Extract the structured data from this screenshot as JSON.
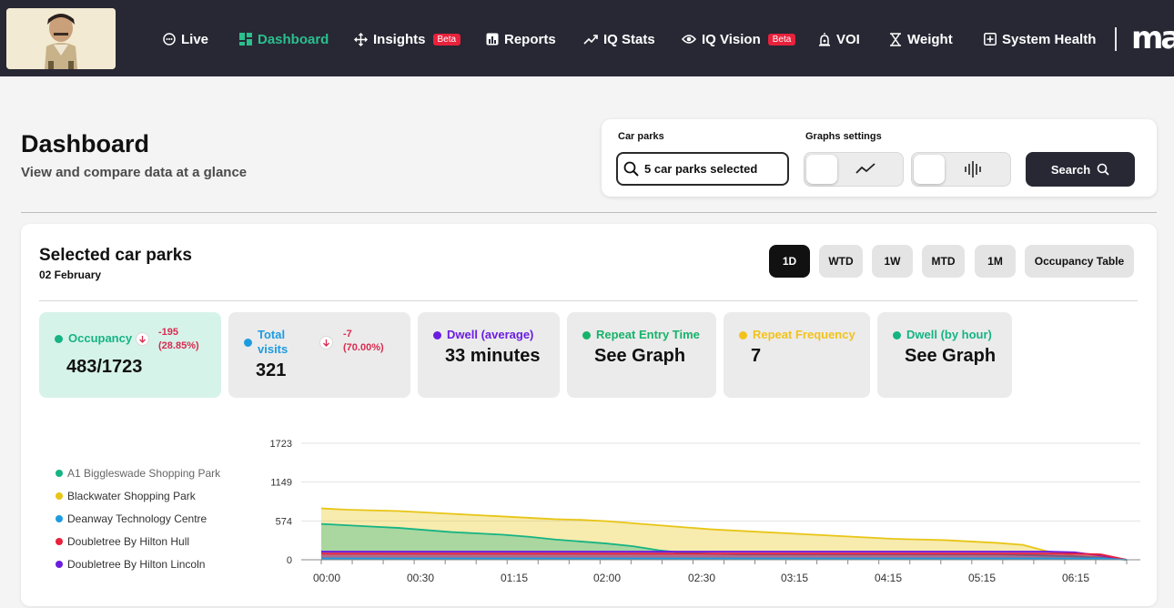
{
  "nav": {
    "items": [
      {
        "label": "Live",
        "icon": "live-circle-icon"
      },
      {
        "label": "Dashboard",
        "icon": "dashboard-grid-icon",
        "active": true
      },
      {
        "label": "Insights",
        "icon": "insights-move-icon",
        "badge": "Beta"
      },
      {
        "label": "Reports",
        "icon": "reports-bar-icon"
      },
      {
        "label": "IQ Stats",
        "icon": "trend-line-icon"
      },
      {
        "label": "IQ Vision",
        "icon": "eye-icon",
        "badge": "Beta"
      },
      {
        "label": "VOI",
        "icon": "alarm-bell-icon"
      },
      {
        "label": "Weight",
        "icon": "hourglass-icon"
      },
      {
        "label": "System Health",
        "icon": "plus-square-icon"
      }
    ],
    "brand": "mav",
    "active_color": "#2bbf8e",
    "badge_color": "#e8213c"
  },
  "header": {
    "title": "Dashboard",
    "subtitle": "View and compare data at a glance"
  },
  "filters": {
    "car_parks_label": "Car parks",
    "car_parks_value": "5 car parks selected",
    "graph_settings_label": "Graphs settings",
    "search_label": "Search"
  },
  "card": {
    "title": "Selected car parks",
    "date": "02 February",
    "ranges": [
      {
        "label": "1D",
        "active": true
      },
      {
        "label": "WTD"
      },
      {
        "label": "1W"
      },
      {
        "label": "MTD"
      },
      {
        "label": "1M"
      },
      {
        "label": "Occupancy Table"
      }
    ]
  },
  "stats": [
    {
      "label": "Occupancy",
      "value": "483/1723",
      "delta_line1": "-195",
      "delta_line2": "(28.85%)",
      "color": "#16b383"
    },
    {
      "label": "Total visits",
      "value": "321",
      "delta_line1": "-7",
      "delta_line2": "(70.00%)",
      "color": "#1e9be0"
    },
    {
      "label": "Dwell (average)",
      "value": "33 minutes",
      "color": "#6a1de0"
    },
    {
      "label": "Repeat Entry Time",
      "value": "See Graph",
      "color": "#16b36a"
    },
    {
      "label": "Repeat Frequency",
      "value": "7",
      "color": "#f2c21b"
    },
    {
      "label": "Dwell (by hour)",
      "value": "See Graph",
      "color": "#16b383"
    }
  ],
  "legend": [
    {
      "name": "A1 Biggleswade Shopping Park",
      "color": "#16b383"
    },
    {
      "name": "Blackwater Shopping Park",
      "color": "#e8c516"
    },
    {
      "name": "Deanway Technology Centre",
      "color": "#1e9be0"
    },
    {
      "name": "Doubletree By Hilton Hull",
      "color": "#e8213c"
    },
    {
      "name": "Doubletree By Hilton Lincoln",
      "color": "#6a1de0"
    }
  ],
  "chart_data": {
    "type": "area",
    "x_ticks": [
      "00:00",
      "00:30",
      "01:15",
      "02:00",
      "02:30",
      "03:15",
      "04:15",
      "05:15",
      "06:15"
    ],
    "y_ticks": [
      0,
      574,
      1149,
      1723
    ],
    "ylim": [
      0,
      1723
    ],
    "x": [
      0,
      30,
      60,
      90,
      120,
      150,
      180,
      210,
      240,
      270,
      300,
      330,
      360,
      390,
      420,
      450,
      480,
      510,
      540,
      570,
      600,
      630,
      660,
      690,
      720,
      750,
      780,
      810,
      840,
      870,
      900,
      930
    ],
    "series": [
      {
        "name": "Blackwater Shopping Park",
        "color": "#e8c516",
        "values": [
          760,
          740,
          730,
          720,
          700,
          680,
          660,
          640,
          620,
          600,
          590,
          570,
          540,
          510,
          480,
          450,
          430,
          410,
          390,
          370,
          350,
          330,
          310,
          300,
          290,
          270,
          250,
          220,
          120,
          60,
          40,
          0
        ]
      },
      {
        "name": "A1 Biggleswade Shopping Park",
        "color": "#16b383",
        "values": [
          530,
          510,
          490,
          470,
          440,
          410,
          390,
          370,
          340,
          300,
          270,
          240,
          200,
          140,
          100,
          90,
          80,
          80,
          80,
          80,
          80,
          80,
          80,
          80,
          80,
          80,
          80,
          70,
          60,
          50,
          30,
          0
        ]
      },
      {
        "name": "Doubletree By Hilton Lincoln",
        "color": "#6a1de0",
        "values": [
          120,
          120,
          120,
          120,
          120,
          120,
          120,
          120,
          120,
          120,
          120,
          120,
          120,
          120,
          120,
          120,
          120,
          120,
          120,
          120,
          120,
          120,
          120,
          120,
          120,
          120,
          120,
          120,
          120,
          110,
          60,
          0
        ]
      },
      {
        "name": "Doubletree By Hilton Hull",
        "color": "#e8213c",
        "values": [
          90,
          90,
          90,
          90,
          90,
          90,
          90,
          90,
          90,
          90,
          90,
          90,
          90,
          90,
          90,
          90,
          90,
          90,
          90,
          90,
          90,
          90,
          90,
          90,
          90,
          90,
          90,
          90,
          90,
          90,
          80,
          0
        ]
      },
      {
        "name": "Deanway Technology Centre",
        "color": "#1e9be0",
        "values": [
          20,
          20,
          20,
          20,
          20,
          20,
          20,
          20,
          20,
          20,
          20,
          20,
          20,
          20,
          20,
          20,
          20,
          20,
          20,
          20,
          20,
          20,
          20,
          20,
          20,
          20,
          20,
          20,
          20,
          20,
          20,
          0
        ]
      }
    ]
  }
}
